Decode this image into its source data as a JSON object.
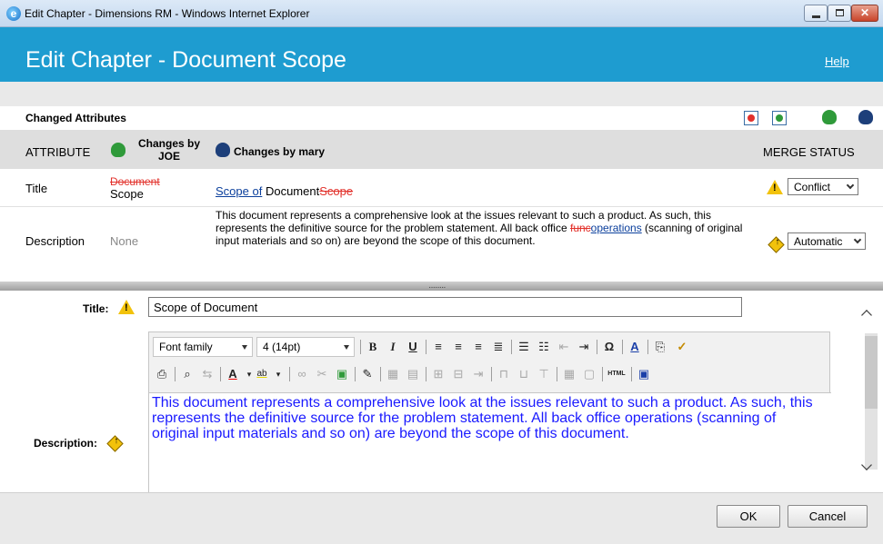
{
  "window": {
    "title": "Edit Chapter - Dimensions RM - Windows Internet Explorer",
    "controls": [
      "minimize",
      "maximize",
      "close"
    ],
    "close_glyph": "✕"
  },
  "header": {
    "title": "Edit Chapter - Document Scope",
    "help_label": "Help",
    "background": "#1e9cd0"
  },
  "changed_attributes": {
    "title": "Changed Attributes",
    "toolbar_icons": [
      "accept-mine-icon",
      "accept-theirs-icon",
      "joe-user-icon",
      "mary-user-icon"
    ],
    "columns": {
      "attribute": "ATTRIBUTE",
      "joe": "Changes by JOE",
      "mary": "Changes by mary",
      "merge_status": "MERGE STATUS"
    },
    "rows": [
      {
        "attribute": "Title",
        "joe_deleted": "Document",
        "joe_text": "Scope",
        "mary_inserted": "Scope of",
        "mary_text": "Document",
        "mary_deleted": "Scope",
        "status_icon": "warning-icon",
        "status": "Conflict"
      },
      {
        "attribute": "Description",
        "joe_text": "None",
        "mary_text_before": "This document represents a comprehensive look at the issues relevant to such a product. As such, this represents the definitive source for the problem statement. All back office ",
        "mary_deleted": "func",
        "mary_inserted": "operations",
        "mary_text_after": " (scanning of original input materials and so on) are beyond the scope of this document.",
        "status_icon": "auto-merge-icon",
        "status": "Automatic"
      }
    ]
  },
  "form": {
    "title_label": "Title:",
    "title_value": "Scope of Document",
    "description_label": "Description:",
    "font_family": "Font family",
    "font_size": "4 (14pt)",
    "description_text": "This document represents a comprehensive look at the issues relevant to such a product. As such, this represents the definitive source for the problem statement. All back office operations (scanning of original input materials and so on) are beyond the scope of this document."
  },
  "editor_toolbar": {
    "bold": "B",
    "italic": "I",
    "underline": "U",
    "special_char": "Ω",
    "html": "HTML"
  },
  "footer": {
    "ok_label": "OK",
    "cancel_label": "Cancel"
  },
  "colors": {
    "conflict": "#f2c20b",
    "deleted_text": "#e2312b",
    "inserted_text": "#0b3f9c",
    "editor_text": "#1a1aff"
  }
}
